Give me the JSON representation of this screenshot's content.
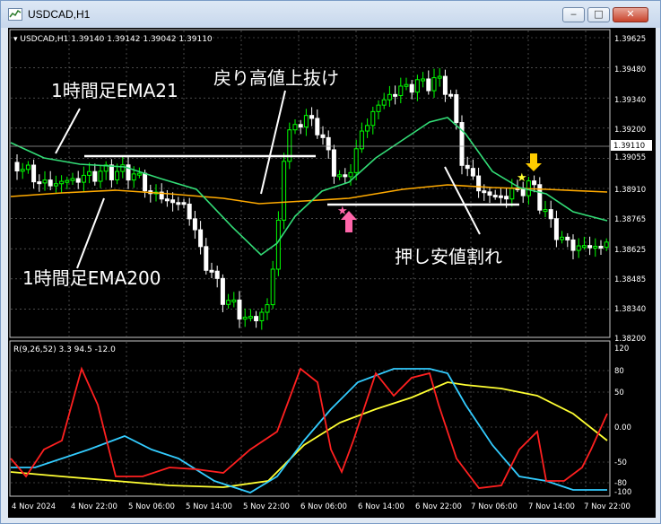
{
  "window": {
    "title": "USDCAD,H1",
    "buttons": {
      "minimize": "‒",
      "maximize": "□",
      "close": "✕"
    }
  },
  "main_panel": {
    "header": "▾ USDCAD,H1  1.39140 1.39142 1.39042 1.39110",
    "price_axis": [
      "1.39625",
      "1.39480",
      "1.39340",
      "1.39200",
      "1.39055",
      "1.38910",
      "1.38765",
      "1.38625",
      "1.38485",
      "1.38340",
      "1.38200"
    ],
    "current_price": "1.39110",
    "annotations": {
      "ema21": "1時間足EMA21",
      "ema200": "1時間足EMA200",
      "breakout": "戻り高値上抜け",
      "breakdown": "押し安値割れ"
    },
    "colors": {
      "bull": "#00ff00",
      "bear": "#ffffff",
      "ema21": "#33dd77",
      "ema200": "#ffaa00",
      "buy_arrow": "#ff66aa",
      "sell_arrow": "#ffff00"
    }
  },
  "indicator_panel": {
    "header": "R(9,26,52) 3.3 94.5 -12.0",
    "axis": [
      "120",
      "80",
      "50",
      "0.00",
      "-50",
      "-80",
      "-100"
    ],
    "colors": {
      "fast": "#ff2020",
      "mid": "#33ccff",
      "slow": "#ffff33"
    }
  },
  "time_axis": [
    "4 Nov 2024",
    "4 Nov 22:00",
    "5 Nov 06:00",
    "5 Nov 14:00",
    "5 Nov 22:00",
    "6 Nov 06:00",
    "6 Nov 14:00",
    "6 Nov 22:00",
    "7 Nov 06:00",
    "7 Nov 14:00",
    "7 Nov 22:00"
  ]
}
